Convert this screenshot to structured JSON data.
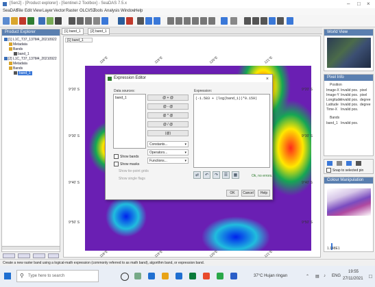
{
  "app": {
    "title": "[Sen2] - [Product explorer] - [Sentinel-2 Toolbox] - SeaDAS 7.5.x"
  },
  "menu": [
    "SeaDAS",
    "File",
    "Edit",
    "View",
    "Layer",
    "Vector",
    "Raster",
    "OLCI/S2",
    "Tools",
    "Analysis",
    "Window",
    "Help"
  ],
  "left_panel": {
    "header": "Product Explorer",
    "tree": [
      {
        "label": "[1] L1C_T37_137M4_20210922",
        "level": 0
      },
      {
        "label": "Metadata",
        "level": 1
      },
      {
        "label": "Bands",
        "level": 1
      },
      {
        "label": "band_1",
        "level": 2
      },
      {
        "label": "[2] L1C_T37_137M4_20210922",
        "level": 0
      },
      {
        "label": "Metadata",
        "level": 1
      },
      {
        "label": "Bands",
        "level": 1
      },
      {
        "label": "band_1",
        "level": 2,
        "selected": true
      }
    ]
  },
  "tabs": [
    "[1] band_1",
    "[2] band_1"
  ],
  "map": {
    "lat_labels_left": [
      "9°20' S",
      "9°30' S",
      "9°40' S",
      "9°50' S"
    ],
    "lat_labels_right": [
      "9°20' S",
      "9°30' S",
      "9°40' S",
      "9°50' S"
    ],
    "lon_labels_top": [
      "118°E",
      "119°E",
      "120°E",
      "121°E"
    ],
    "lon_labels_bottom": [
      "118°E",
      "119°E",
      "120°E",
      "121°E"
    ]
  },
  "dialog": {
    "title": "Expression Editor",
    "data_sources_label": "Data sources:",
    "data_sources": [
      "band_1"
    ],
    "expression_label": "Expression:",
    "expression_value": "(-1.583 + (log(band_1))*0.159)",
    "operator_buttons": [
      "@ + @",
      "@ - @",
      "@ * @",
      "@ / @",
      "(@)"
    ],
    "dropdowns": [
      "Constants...",
      "Operators...",
      "Functions..."
    ],
    "show_bands": "Show bands",
    "show_masks": "Show masks",
    "show_tie_point_grids": "Show tie-point grids",
    "show_single_flags": "Show single flags",
    "status": "Ok, no errors.",
    "ok": "OK",
    "cancel": "Cancel",
    "help": "Help"
  },
  "right_panel": {
    "nav_header": "World View",
    "pixel_header": "Pixel Info",
    "pixel_rows": [
      [
        "Position",
        ""
      ],
      [
        "Image-X",
        "Invalid pos.",
        "pixel"
      ],
      [
        "Image-Y",
        "Invalid pos.",
        "pixel"
      ],
      [
        "Longitude",
        "Invalid pos.",
        "degree"
      ],
      [
        "Latitude",
        "Invalid pos.",
        "degree"
      ],
      [
        "Time-X",
        "Invalid pos.",
        ""
      ]
    ],
    "bands_header": "Bands",
    "bands_row": [
      "band_1",
      "Invalid pos."
    ],
    "snap_label": "Snap to selected pin",
    "layer_header": "Colour Manipulation",
    "scale_value": "1.148E1"
  },
  "statusbar": "Create a new raster band using a logical-math expression (commonly referred to as math band), algorithm band, or expression band.",
  "taskbar": {
    "search_placeholder": "Type here to search",
    "weather": "37°C Hujan ringan",
    "time": "19:55",
    "date": "27/11/2021",
    "lang": "ENG"
  }
}
